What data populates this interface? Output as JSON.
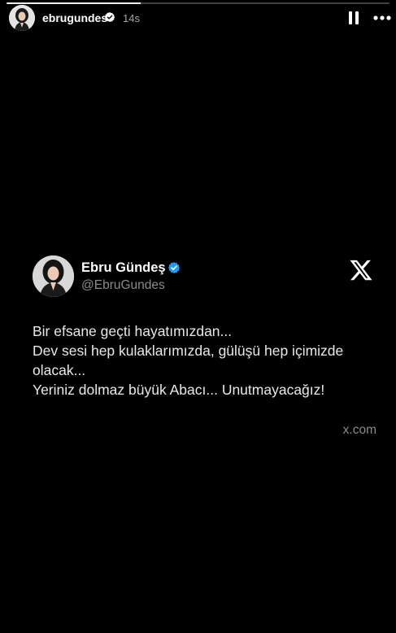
{
  "story": {
    "progress": 0.35,
    "username": "ebrugundes",
    "time_ago": "14s",
    "pause_icon": "pause-icon",
    "more_icon": "more-icon"
  },
  "tweet": {
    "display_name": "Ebru Gündeş",
    "handle": "@EbruGundes",
    "text": "Bir efsane geçti hayatımızdan...\nDev sesi hep kulaklarımızda, gülüşü hep içimizde olacak...\nYeriniz dolmaz büyük Abacı... Unutmayacağız!",
    "source": "x.com",
    "logo_icon": "x-logo-icon"
  },
  "colors": {
    "background": "#000000",
    "text": "#ffffff",
    "muted": "#8b8b8b",
    "verified": "#1d9bf0"
  }
}
